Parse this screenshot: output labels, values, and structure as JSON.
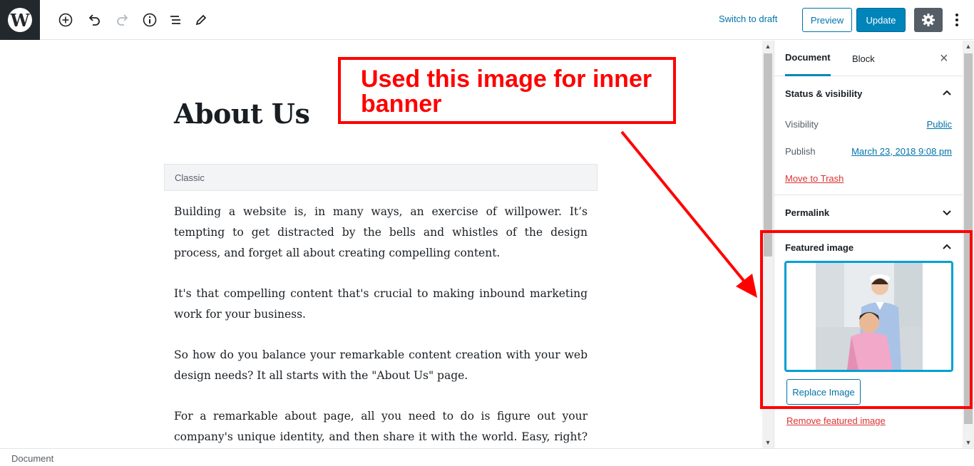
{
  "toolbar": {
    "switch_to_draft": "Switch to draft",
    "preview": "Preview",
    "update": "Update"
  },
  "editor": {
    "title": "About Us",
    "block_label": "Classic",
    "paragraphs": [
      "Building a website is, in many ways, an exercise of willpower. It’s tempting to get distracted by the bells and whistles of the design process, and forget all about creating compelling content.",
      "It's that compelling content that's crucial to making inbound marketing work for your business.",
      "So how do you balance your remarkable content creation with your web design needs? It all starts with the \"About Us\" page.",
      "For a remarkable about page, all you need to do is figure out your company's unique identity, and then share it with the world. Easy, right? Of"
    ]
  },
  "sidebar": {
    "tabs": [
      "Document",
      "Block"
    ],
    "status": {
      "heading": "Status & visibility",
      "visibility_label": "Visibility",
      "visibility_value": "Public",
      "publish_label": "Publish",
      "publish_value": "March 23, 2018 9:08 pm",
      "trash": "Move to Trash"
    },
    "permalink": "Permalink",
    "featured_image": {
      "heading": "Featured image",
      "replace": "Replace Image",
      "remove": "Remove featured image"
    }
  },
  "footer": {
    "breadcrumb": "Document"
  },
  "annotation": {
    "line1": "Used this image for inner",
    "line2": "banner"
  }
}
